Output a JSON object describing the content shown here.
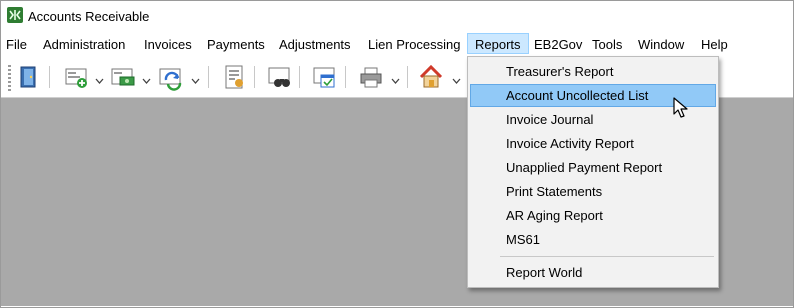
{
  "window": {
    "title": "Accounts Receivable"
  },
  "menubar": {
    "items": [
      "File",
      "Administration",
      "Invoices",
      "Payments",
      "Adjustments",
      "Lien Processing",
      "Reports",
      "EB2Gov",
      "Tools",
      "Window",
      "Help"
    ],
    "active": "Reports"
  },
  "toolbar": {
    "buttons": [
      "exit-icon",
      "add-record-icon",
      "payment-icon",
      "refresh-icon",
      "report-list-icon",
      "binoculars-icon",
      "calendar-icon",
      "printer-icon",
      "home-icon"
    ]
  },
  "reports_menu": {
    "items": [
      "Treasurer's Report",
      "Account Uncollected List",
      "Invoice Journal",
      "Invoice Activity Report",
      "Unapplied Payment Report",
      "Print Statements",
      "AR Aging Report",
      "MS61",
      "Report World"
    ],
    "highlighted": "Account Uncollected List"
  },
  "colors": {
    "highlight": "#91c9f7",
    "workspace": "#a9a9a9",
    "menu_active": "#cce8ff"
  }
}
